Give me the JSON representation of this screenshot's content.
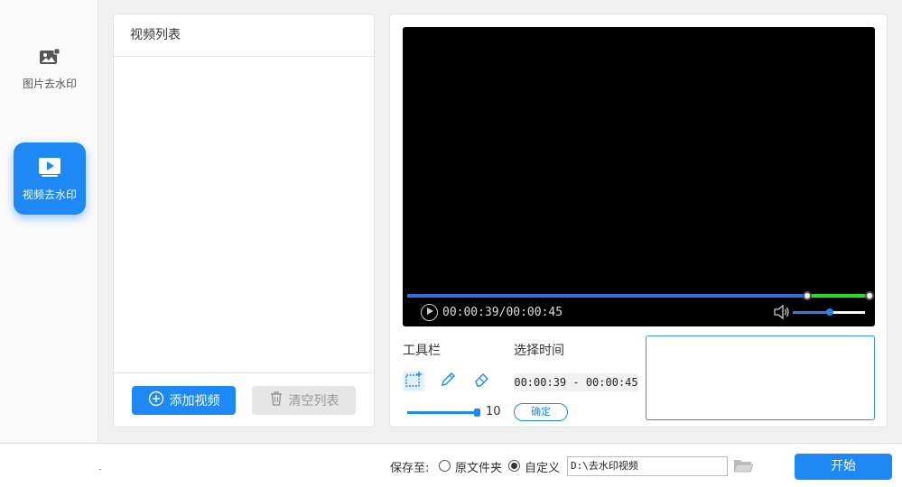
{
  "sidebar": {
    "items": [
      {
        "label": "图片去水印",
        "icon": "image-icon",
        "active": false
      },
      {
        "label": "视频去水印",
        "icon": "video-play-icon",
        "active": true
      }
    ]
  },
  "video_list": {
    "title": "视频列表",
    "add_button": "添加视频",
    "clear_button": "清空列表",
    "items": []
  },
  "player": {
    "time_display": "00:00:39/00:00:45",
    "progress_fraction": 0.85,
    "selection_start_fraction": 0.86,
    "volume_fraction": 0.5
  },
  "toolbar": {
    "label": "工具栏",
    "tools": [
      "rect-select-icon",
      "pencil-icon",
      "eraser-icon"
    ],
    "brush_size": "10"
  },
  "time_select": {
    "label": "选择时间",
    "range": "00:00:39 - 00:00:45",
    "confirm_button": "确定"
  },
  "bottom": {
    "save_to_label": "保存至:",
    "option_original": "原文件夹",
    "option_custom": "自定义",
    "selected_option": "custom",
    "path": "D:\\去水印视频",
    "start_button": "开始"
  },
  "colors": {
    "accent": "#1e88f5",
    "progress": "#2f6fd8",
    "selection": "#22dd22"
  }
}
